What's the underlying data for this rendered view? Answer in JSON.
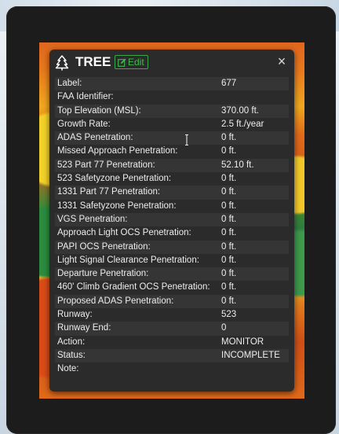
{
  "popup": {
    "title": "TREE",
    "edit_label": "Edit",
    "close_glyph": "×",
    "icons": {
      "title": "tree-icon",
      "edit": "edit-icon",
      "close": "close-icon"
    },
    "colors": {
      "accent": "#3dbb4e",
      "panel": "#2b2b2b",
      "text": "#ededed"
    },
    "fields": [
      {
        "label": "Label:",
        "value": "677"
      },
      {
        "label": "FAA Identifier:",
        "value": ""
      },
      {
        "label": "Top Elevation (MSL):",
        "value": "370.00 ft."
      },
      {
        "label": "Growth Rate:",
        "value": "2.5 ft./year"
      },
      {
        "label": "ADAS Penetration:",
        "value": "0 ft."
      },
      {
        "label": "Missed Approach Penetration:",
        "value": "0 ft."
      },
      {
        "label": "523 Part 77 Penetration:",
        "value": "52.10 ft."
      },
      {
        "label": "523 Safetyzone Penetration:",
        "value": "0 ft."
      },
      {
        "label": "1331 Part 77 Penetration:",
        "value": "0 ft."
      },
      {
        "label": "1331 Safetyzone Penetration:",
        "value": "0 ft."
      },
      {
        "label": "VGS Penetration:",
        "value": "0 ft."
      },
      {
        "label": "Approach Light OCS Penetration:",
        "value": "0 ft."
      },
      {
        "label": "PAPI OCS Penetration:",
        "value": "0 ft."
      },
      {
        "label": "Light Signal Clearance Penetration:",
        "value": "0 ft."
      },
      {
        "label": "Departure Penetration:",
        "value": "0 ft."
      },
      {
        "label": "460' Climb Gradient OCS Penetration:",
        "value": "0 ft."
      },
      {
        "label": "Proposed ADAS Penetration:",
        "value": "0 ft."
      },
      {
        "label": "Runway:",
        "value": "523"
      },
      {
        "label": "Runway End:",
        "value": "0"
      },
      {
        "label": "Action:",
        "value": "MONITOR"
      },
      {
        "label": "Status:",
        "value": "INCOMPLETE"
      },
      {
        "label": "Note:",
        "value": ""
      }
    ]
  }
}
